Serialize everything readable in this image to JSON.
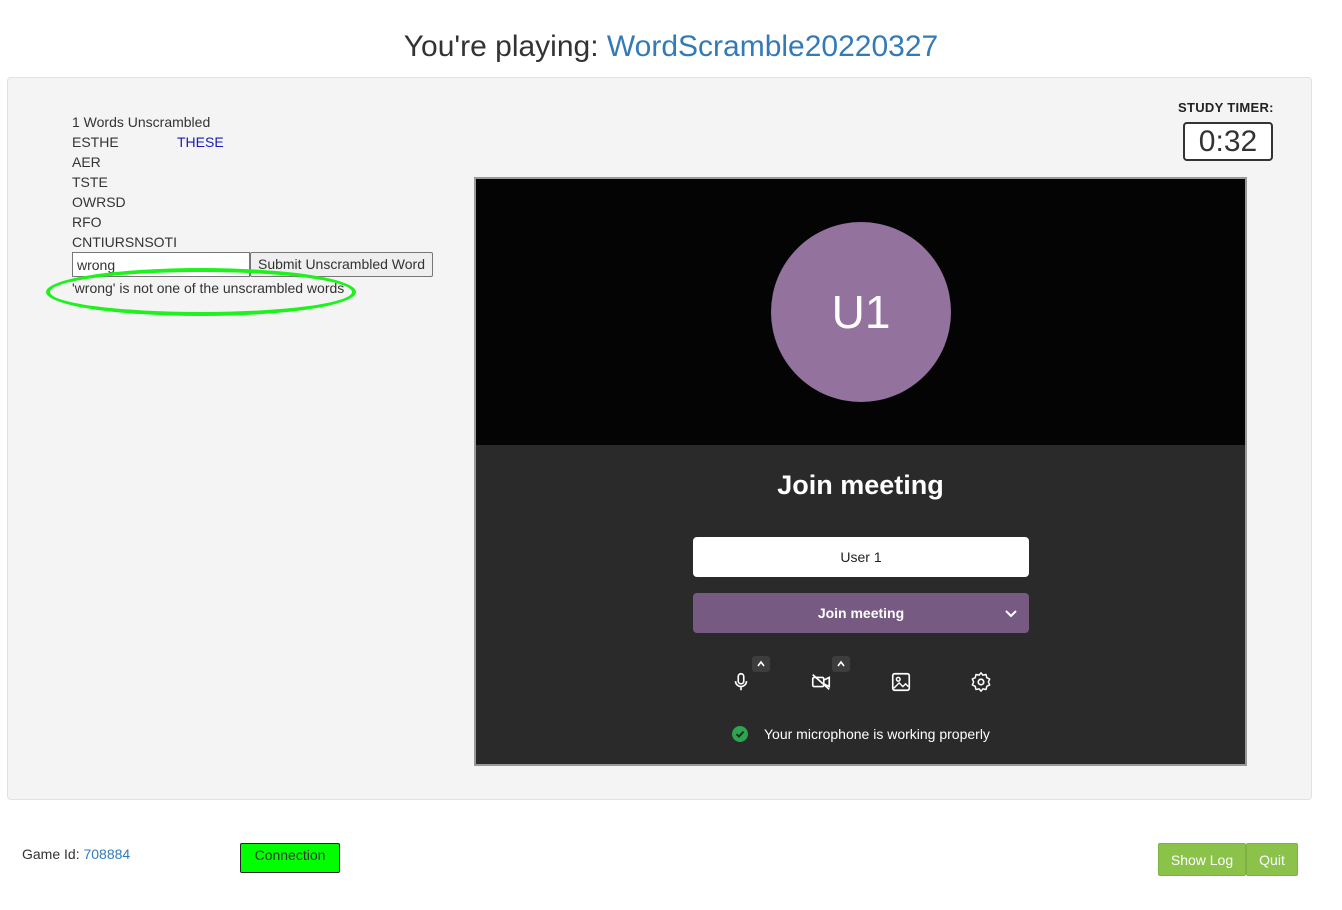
{
  "header": {
    "prefix": "You're playing: ",
    "game_name": "WordScramble20220327"
  },
  "game": {
    "unscrambled_count_text": "1 Words Unscrambled",
    "words": [
      {
        "scrambled": "ESTHE",
        "answer": "THESE"
      },
      {
        "scrambled": "AER",
        "answer": ""
      },
      {
        "scrambled": "TSTE",
        "answer": ""
      },
      {
        "scrambled": "OWRSD",
        "answer": ""
      },
      {
        "scrambled": "RFO",
        "answer": ""
      },
      {
        "scrambled": "CNTIURSNSOTI",
        "answer": ""
      }
    ],
    "guess_value": "wrong",
    "submit_label": "Submit Unscrambled Word",
    "feedback": "'wrong' is not one of the unscrambled words"
  },
  "timer": {
    "label": "STUDY TIMER:",
    "value": "0:32"
  },
  "meeting": {
    "avatar_initials": "U1",
    "title": "Join meeting",
    "name_value": "User 1",
    "join_label": "Join meeting",
    "mic_status": "Your microphone is working properly",
    "colors": {
      "avatar": "#93739d",
      "join_button": "#775a82",
      "status_ok": "#2ea44f"
    }
  },
  "footer": {
    "game_id_label": "Game Id: ",
    "game_id_value": "708884",
    "connection_label": "Connection",
    "show_log_label": "Show Log",
    "quit_label": "Quit"
  }
}
